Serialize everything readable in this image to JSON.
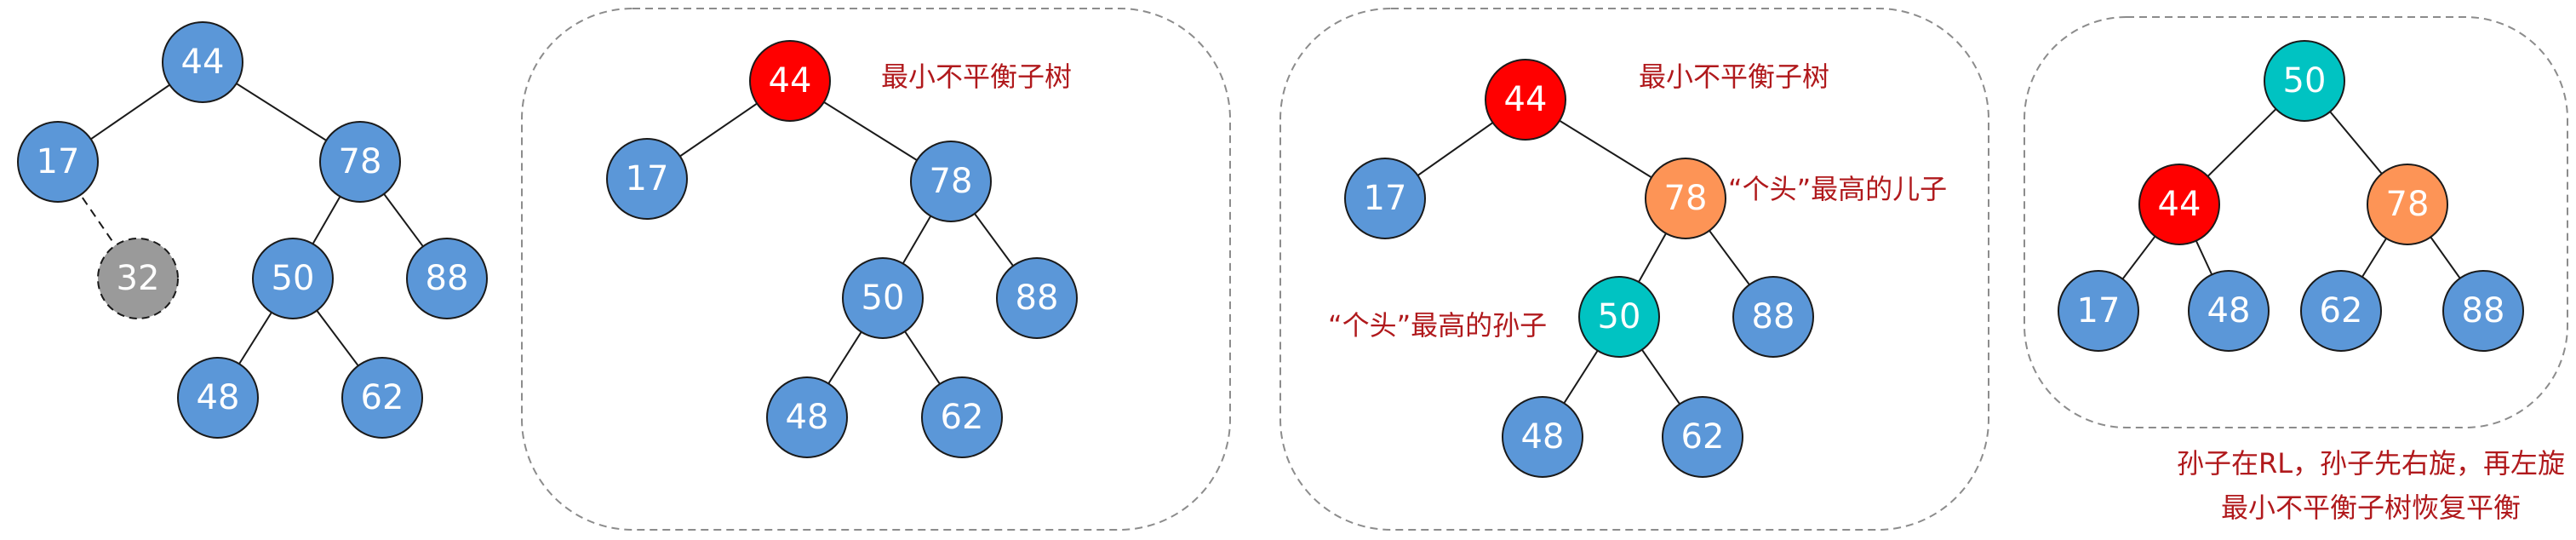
{
  "colors": {
    "node_default": "#5b97d8",
    "node_red": "#ff0000",
    "node_orange": "#fd9456",
    "node_teal": "#00c3c2",
    "node_gray": "#9a9a9a",
    "annotation_text": "#b0191c"
  },
  "panels": [
    {
      "id": "original",
      "framed": false,
      "nodes": [
        {
          "id": "44",
          "label": "44",
          "color": "default"
        },
        {
          "id": "17",
          "label": "17",
          "color": "default"
        },
        {
          "id": "78",
          "label": "78",
          "color": "default"
        },
        {
          "id": "32",
          "label": "32",
          "color": "gray",
          "dashed": true
        },
        {
          "id": "50",
          "label": "50",
          "color": "default"
        },
        {
          "id": "88",
          "label": "88",
          "color": "default"
        },
        {
          "id": "48",
          "label": "48",
          "color": "default"
        },
        {
          "id": "62",
          "label": "62",
          "color": "default"
        }
      ],
      "edges": [
        {
          "from": "44",
          "to": "17"
        },
        {
          "from": "44",
          "to": "78"
        },
        {
          "from": "17",
          "to": "32",
          "dashed": true
        },
        {
          "from": "78",
          "to": "50"
        },
        {
          "from": "78",
          "to": "88"
        },
        {
          "from": "50",
          "to": "48"
        },
        {
          "from": "50",
          "to": "62"
        }
      ],
      "annotations": []
    },
    {
      "id": "unbalanced",
      "framed": true,
      "nodes": [
        {
          "id": "44",
          "label": "44",
          "color": "red"
        },
        {
          "id": "17",
          "label": "17",
          "color": "default"
        },
        {
          "id": "78",
          "label": "78",
          "color": "default"
        },
        {
          "id": "50",
          "label": "50",
          "color": "default"
        },
        {
          "id": "88",
          "label": "88",
          "color": "default"
        },
        {
          "id": "48",
          "label": "48",
          "color": "default"
        },
        {
          "id": "62",
          "label": "62",
          "color": "default"
        }
      ],
      "edges": [
        {
          "from": "44",
          "to": "17"
        },
        {
          "from": "44",
          "to": "78"
        },
        {
          "from": "78",
          "to": "50"
        },
        {
          "from": "78",
          "to": "88"
        },
        {
          "from": "50",
          "to": "48"
        },
        {
          "from": "50",
          "to": "62"
        }
      ],
      "annotations": [
        {
          "text": "最小不平衡子树"
        }
      ]
    },
    {
      "id": "identify",
      "framed": true,
      "nodes": [
        {
          "id": "44",
          "label": "44",
          "color": "red"
        },
        {
          "id": "17",
          "label": "17",
          "color": "default"
        },
        {
          "id": "78",
          "label": "78",
          "color": "orange"
        },
        {
          "id": "50",
          "label": "50",
          "color": "teal"
        },
        {
          "id": "88",
          "label": "88",
          "color": "default"
        },
        {
          "id": "48",
          "label": "48",
          "color": "default"
        },
        {
          "id": "62",
          "label": "62",
          "color": "default"
        }
      ],
      "edges": [
        {
          "from": "44",
          "to": "17"
        },
        {
          "from": "44",
          "to": "78"
        },
        {
          "from": "78",
          "to": "50"
        },
        {
          "from": "78",
          "to": "88"
        },
        {
          "from": "50",
          "to": "48"
        },
        {
          "from": "50",
          "to": "62"
        }
      ],
      "annotations": [
        {
          "text": "最小不平衡子树"
        },
        {
          "text": "“个头”最高的儿子"
        },
        {
          "text": "“个头”最高的孙子"
        }
      ]
    },
    {
      "id": "rebalanced",
      "framed": true,
      "nodes": [
        {
          "id": "50",
          "label": "50",
          "color": "teal"
        },
        {
          "id": "44",
          "label": "44",
          "color": "red"
        },
        {
          "id": "78",
          "label": "78",
          "color": "orange"
        },
        {
          "id": "17",
          "label": "17",
          "color": "default"
        },
        {
          "id": "48",
          "label": "48",
          "color": "default"
        },
        {
          "id": "62",
          "label": "62",
          "color": "default"
        },
        {
          "id": "88",
          "label": "88",
          "color": "default"
        }
      ],
      "edges": [
        {
          "from": "50",
          "to": "44"
        },
        {
          "from": "50",
          "to": "78"
        },
        {
          "from": "44",
          "to": "17"
        },
        {
          "from": "44",
          "to": "48"
        },
        {
          "from": "78",
          "to": "62"
        },
        {
          "from": "78",
          "to": "88"
        }
      ],
      "annotations": [
        {
          "text": "孙子在RL，孙子先右旋，再左旋"
        },
        {
          "text": "最小不平衡子树恢复平衡"
        }
      ]
    }
  ]
}
